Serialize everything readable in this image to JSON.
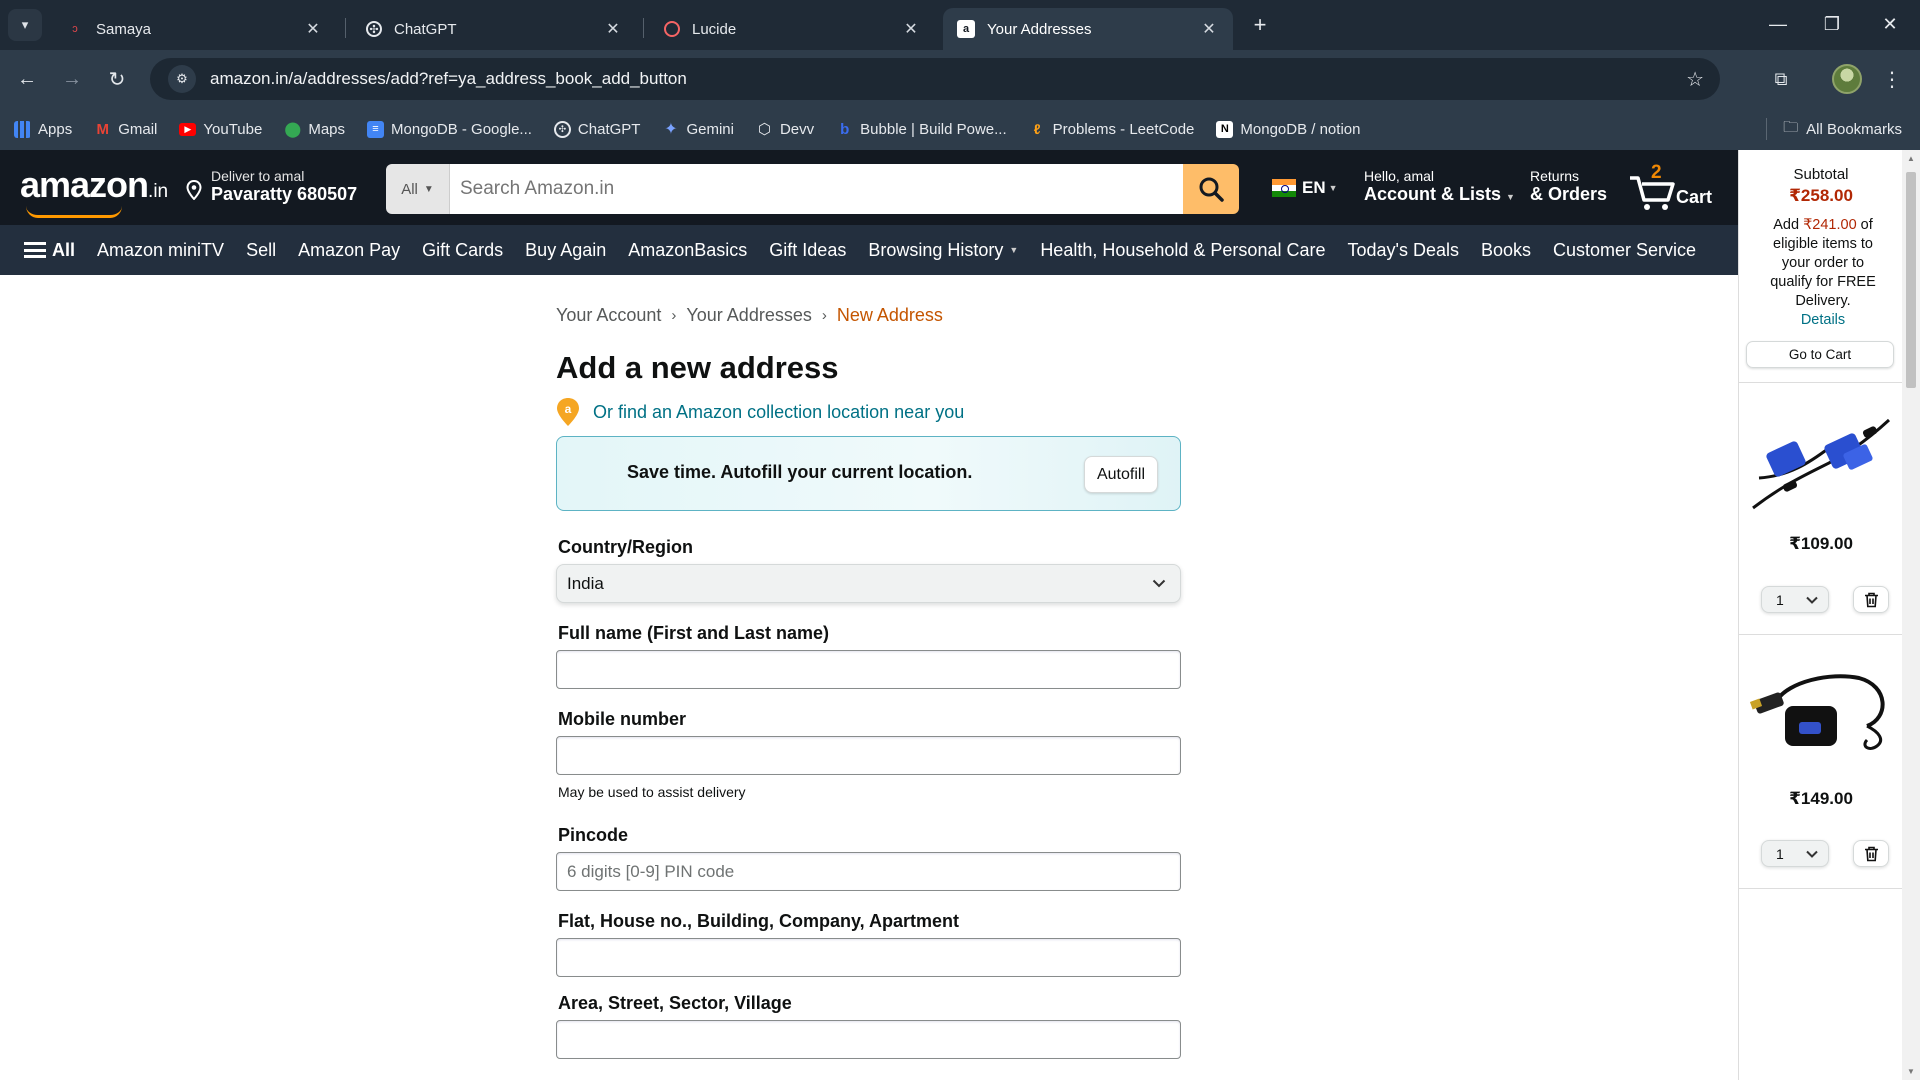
{
  "browser": {
    "tabs": [
      {
        "title": "Samaya",
        "favicon": "samaya-icon",
        "active": false
      },
      {
        "title": "ChatGPT",
        "favicon": "chatgpt-icon",
        "active": false
      },
      {
        "title": "Lucide",
        "favicon": "lucide-icon",
        "active": false
      },
      {
        "title": "Your Addresses",
        "favicon": "amazon-icon",
        "active": true
      }
    ],
    "url": "amazon.in/a/addresses/add?ref=ya_address_book_add_button",
    "bookmarks": [
      {
        "label": "Apps",
        "icon": "apps-grid-icon"
      },
      {
        "label": "Gmail",
        "icon": "gmail-icon"
      },
      {
        "label": "YouTube",
        "icon": "youtube-icon"
      },
      {
        "label": "Maps",
        "icon": "maps-icon"
      },
      {
        "label": "MongoDB - Google...",
        "icon": "docs-icon"
      },
      {
        "label": "ChatGPT",
        "icon": "chatgpt-icon"
      },
      {
        "label": "Gemini",
        "icon": "gemini-icon"
      },
      {
        "label": "Devv",
        "icon": "devv-icon"
      },
      {
        "label": "Bubble | Build Powe...",
        "icon": "bubble-icon"
      },
      {
        "label": "Problems - LeetCode",
        "icon": "leetcode-icon"
      },
      {
        "label": "MongoDB / notion",
        "icon": "notion-icon"
      }
    ],
    "all_bookmarks": "All Bookmarks"
  },
  "header": {
    "logo": "amazon",
    "logo_suffix": ".in",
    "deliver_line1": "Deliver to amal",
    "deliver_line2": "Pavaratty 680507",
    "search_category": "All",
    "search_placeholder": "Search Amazon.in",
    "language": "EN",
    "account_line1": "Hello, amal",
    "account_line2": "Account & Lists",
    "returns_line1": "Returns",
    "returns_line2": "& Orders",
    "cart_count": "2",
    "cart_label": "Cart"
  },
  "nav": {
    "all": "All",
    "items": [
      "Amazon miniTV",
      "Sell",
      "Amazon Pay",
      "Gift Cards",
      "Buy Again",
      "AmazonBasics",
      "Gift Ideas",
      "Browsing History",
      "Health, Household & Personal Care",
      "Today's Deals",
      "Books",
      "Customer Service"
    ]
  },
  "breadcrumb": [
    "Your Account",
    "Your Addresses",
    "New Address"
  ],
  "form": {
    "title": "Add a new address",
    "collection_link": "Or find an Amazon collection location near you",
    "autofill_text": "Save time. Autofill your current location.",
    "autofill_button": "Autofill",
    "country_label": "Country/Region",
    "country_value": "India",
    "fullname_label": "Full name (First and Last name)",
    "fullname_value": "",
    "mobile_label": "Mobile number",
    "mobile_value": "",
    "mobile_hint": "May be used to assist delivery",
    "pincode_label": "Pincode",
    "pincode_placeholder": "6 digits [0-9] PIN code",
    "flat_label": "Flat, House no., Building, Company, Apartment",
    "flat_value": "",
    "area_label": "Area, Street, Sector, Village",
    "area_value": ""
  },
  "side_cart": {
    "subtotal_label": "Subtotal",
    "subtotal_value": "₹258.00",
    "msg_prefix": "Add",
    "msg_amount": "₹241.00",
    "msg_suffix": "of eligible items to your order to qualify for FREE Delivery.",
    "details_link": "Details",
    "go_to_cart": "Go to Cart",
    "items": [
      {
        "name": "VGA cable",
        "price": "₹109.00",
        "qty": "1"
      },
      {
        "name": "HDMI to VGA adapter",
        "price": "₹149.00",
        "qty": "1"
      }
    ]
  },
  "colors": {
    "amazon_dark": "#131921",
    "amazon_nav": "#232f3e",
    "amazon_orange": "#febd69",
    "link_teal": "#007185",
    "price_red": "#b12704",
    "breadcrumb_current": "#c45500"
  }
}
